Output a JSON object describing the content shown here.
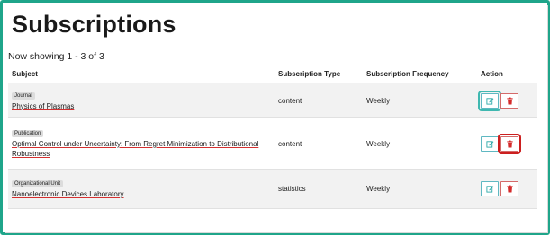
{
  "page": {
    "title": "Subscriptions",
    "showing": "Now showing 1 - 3 of 3"
  },
  "table": {
    "headers": [
      "Subject",
      "Subscription Type",
      "Subscription Frequency",
      "Action"
    ],
    "rows": [
      {
        "category": "Journal",
        "subject": "Physics of Plasmas",
        "type": "content",
        "frequency": "Weekly"
      },
      {
        "category": "Publication",
        "subject": "Optimal Control under Uncertainty: From Regret Minimization to Distributional Robustness",
        "type": "content",
        "frequency": "Weekly"
      },
      {
        "category": "Organizational Unit",
        "subject": "Nanoelectronic Devices Laboratory",
        "type": "statistics",
        "frequency": "Weekly"
      }
    ]
  },
  "colors": {
    "frame_border": "#1fa58a",
    "edit_accent": "#2aa8a8",
    "delete_accent": "#d42a2a",
    "link_underline": "#d43030"
  },
  "icons": {
    "edit": "edit-icon",
    "delete": "trash-icon"
  }
}
